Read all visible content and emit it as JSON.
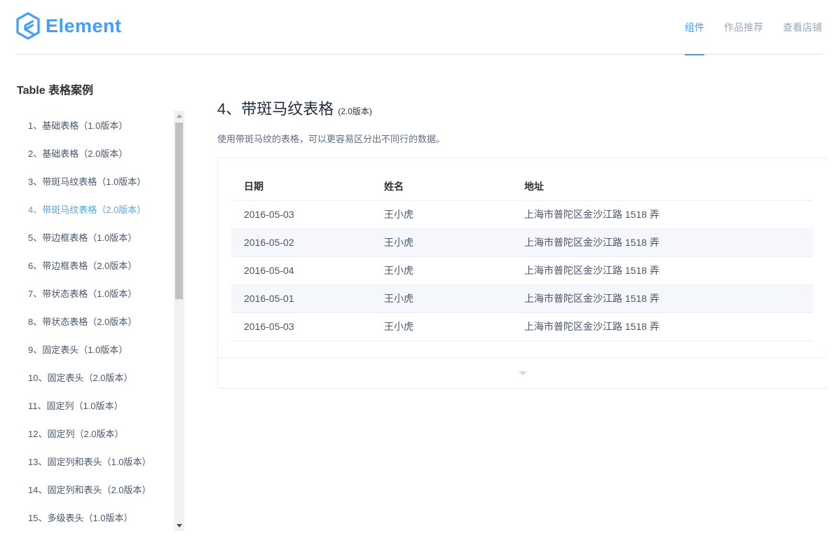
{
  "header": {
    "logo_text": "Element",
    "nav": [
      {
        "label": "组件",
        "active": true
      },
      {
        "label": "作品推荐",
        "active": false
      },
      {
        "label": "查看店铺",
        "active": false
      }
    ]
  },
  "sidebar": {
    "title": "Table 表格案例",
    "items": [
      "1、基础表格（1.0版本）",
      "2、基础表格（2.0版本）",
      "3、带斑马纹表格（1.0版本）",
      "4、带斑马纹表格（2.0版本）",
      "5、带边框表格（1.0版本）",
      "6、带边框表格（2.0版本）",
      "7、带状态表格（1.0版本）",
      "8、带状态表格（2.0版本）",
      "9、固定表头（1.0版本）",
      "10、固定表头（2.0版本）",
      "11、固定列（1.0版本）",
      "12、固定列（2.0版本）",
      "13、固定列和表头（1.0版本）",
      "14、固定列和表头（2.0版本）",
      "15、多级表头（1.0版本）"
    ],
    "active_index": 3
  },
  "main": {
    "title": "4、带斑马纹表格",
    "version": "(2.0版本)",
    "description": "使用带斑马纹的表格，可以更容易区分出不同行的数据。",
    "table": {
      "headers": [
        "日期",
        "姓名",
        "地址"
      ],
      "rows": [
        [
          "2016-05-03",
          "王小虎",
          "上海市普陀区金沙江路 1518 弄"
        ],
        [
          "2016-05-02",
          "王小虎",
          "上海市普陀区金沙江路 1518 弄"
        ],
        [
          "2016-05-04",
          "王小虎",
          "上海市普陀区金沙江路 1518 弄"
        ],
        [
          "2016-05-01",
          "王小虎",
          "上海市普陀区金沙江路 1518 弄"
        ],
        [
          "2016-05-03",
          "王小虎",
          "上海市普陀区金沙江路 1518 弄"
        ]
      ]
    }
  },
  "colors": {
    "primary": "#409eff",
    "active_menu": "#58a5e4",
    "stripe": "#f5f7fa"
  },
  "icons": {
    "logo": "element-hexagon-logo-icon",
    "expand": "caret-down-icon"
  }
}
